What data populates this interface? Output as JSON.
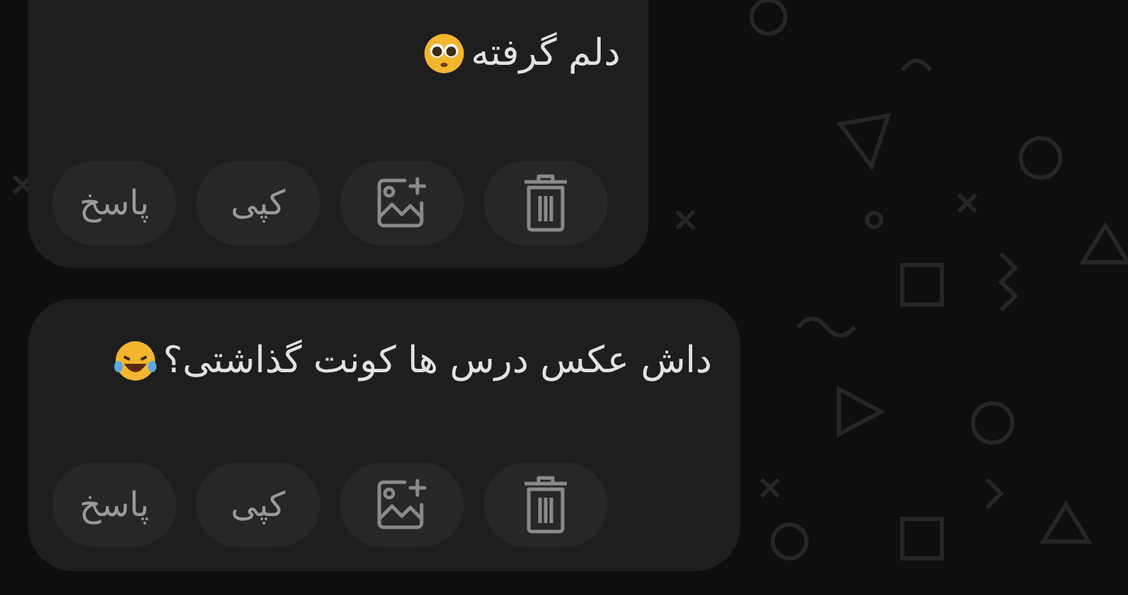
{
  "messages": [
    {
      "text": "دلم گرفته",
      "kind": "pleading",
      "actions": [
        {
          "kind": "delete"
        },
        {
          "kind": "add-image"
        },
        {
          "kind": "copy",
          "label": "کپی"
        },
        {
          "kind": "reply",
          "label": "پاسخ"
        }
      ]
    },
    {
      "text": "داش عکس درس ها کونت گذاشتی؟",
      "kind": "laughing",
      "actions": [
        {
          "kind": "delete"
        },
        {
          "kind": "add-image"
        },
        {
          "kind": "copy",
          "label": "کپی"
        },
        {
          "kind": "reply",
          "label": "پاسخ"
        }
      ]
    }
  ]
}
